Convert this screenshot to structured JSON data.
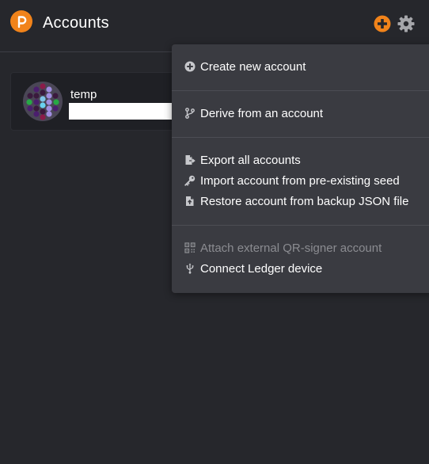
{
  "header": {
    "title": "Accounts",
    "logo_icon": "polkadot-logo-icon",
    "add_icon": "plus-circle-icon",
    "settings_icon": "gear-icon"
  },
  "account": {
    "name": "temp",
    "address": ""
  },
  "menu": {
    "create_new_account": "Create new account",
    "derive_from_account": "Derive from an account",
    "export_all_accounts": "Export all accounts",
    "import_from_seed": "Import account from pre-existing seed",
    "restore_from_json": "Restore account from backup JSON file",
    "attach_qr_signer": "Attach external QR-signer account",
    "connect_ledger": "Connect Ledger device"
  },
  "colors": {
    "accent": "#f1831a",
    "background": "#26272c",
    "menu_background": "#3a3b41",
    "card_background": "#1f2025",
    "disabled_text": "#8b8c91"
  }
}
